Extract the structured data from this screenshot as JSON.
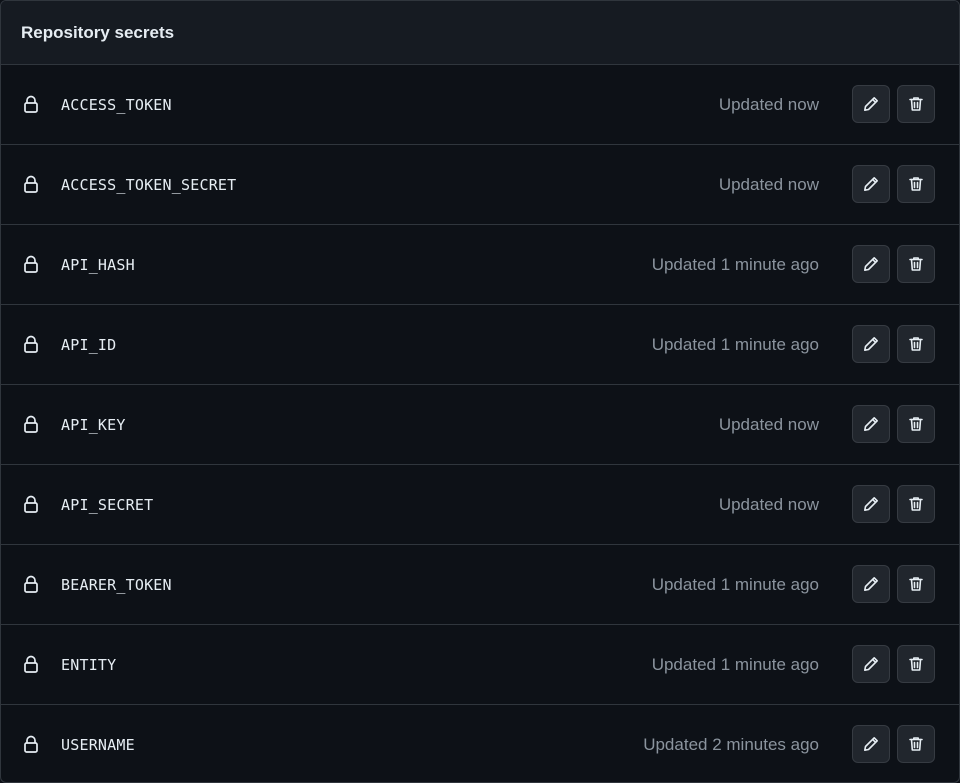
{
  "header": {
    "title": "Repository secrets"
  },
  "icons": {
    "row_icon": "lock-icon",
    "edit_icon": "pencil-icon",
    "delete_icon": "trash-icon"
  },
  "colors": {
    "background": "#0d1117",
    "header_background": "#161b22",
    "border": "#30363d",
    "text_primary": "#e6edf3",
    "text_muted": "#8b949e",
    "button_background": "#21262d"
  },
  "secrets": [
    {
      "name": "ACCESS_TOKEN",
      "updated": "Updated now"
    },
    {
      "name": "ACCESS_TOKEN_SECRET",
      "updated": "Updated now"
    },
    {
      "name": "API_HASH",
      "updated": "Updated 1 minute ago"
    },
    {
      "name": "API_ID",
      "updated": "Updated 1 minute ago"
    },
    {
      "name": "API_KEY",
      "updated": "Updated now"
    },
    {
      "name": "API_SECRET",
      "updated": "Updated now"
    },
    {
      "name": "BEARER_TOKEN",
      "updated": "Updated 1 minute ago"
    },
    {
      "name": "ENTITY",
      "updated": "Updated 1 minute ago"
    },
    {
      "name": "USERNAME",
      "updated": "Updated 2 minutes ago"
    }
  ]
}
